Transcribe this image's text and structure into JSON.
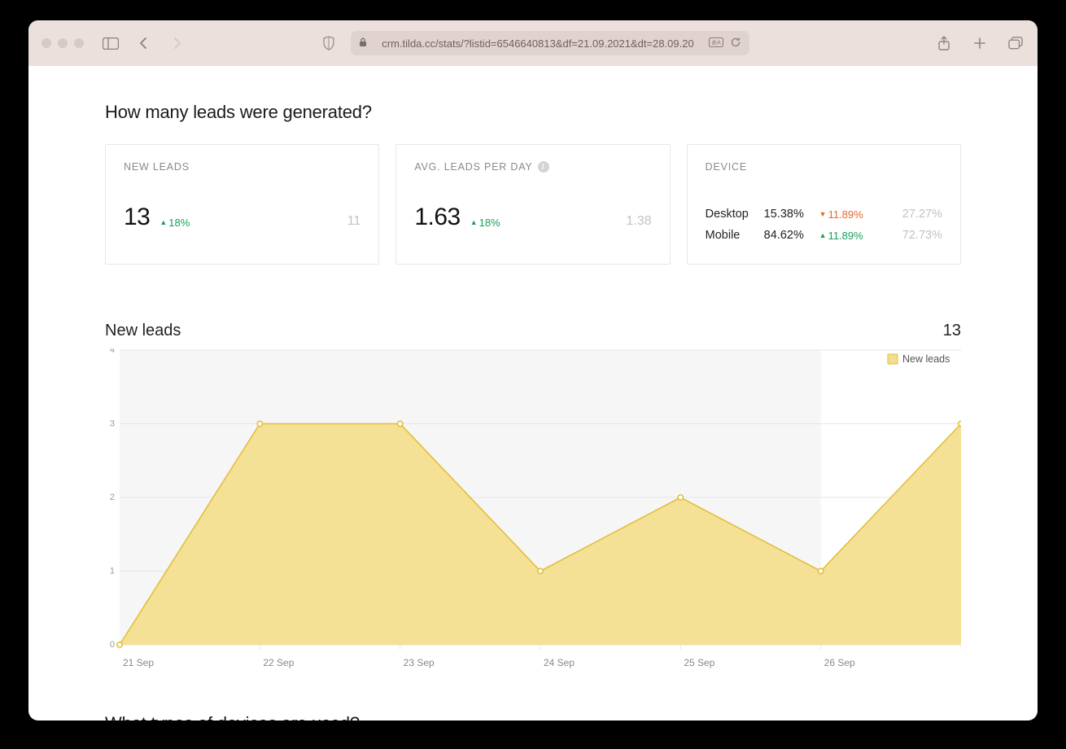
{
  "browser": {
    "url": "crm.tilda.cc/stats/?listid=6546640813&df=21.09.2021&dt=28.09.20"
  },
  "section1_title": "How many leads were generated?",
  "cards": {
    "new_leads": {
      "title": "NEW LEADS",
      "value": "13",
      "delta_dir": "up",
      "delta": "18%",
      "prev": "11"
    },
    "avg_leads": {
      "title": "AVG. LEADS PER DAY",
      "value": "1.63",
      "delta_dir": "up",
      "delta": "18%",
      "prev": "1.38"
    },
    "device": {
      "title": "DEVICE",
      "rows": [
        {
          "label": "Desktop",
          "value": "15.38%",
          "delta_dir": "down",
          "delta": "11.89%",
          "prev": "27.27%"
        },
        {
          "label": "Mobile",
          "value": "84.62%",
          "delta_dir": "up",
          "delta": "11.89%",
          "prev": "72.73%"
        }
      ]
    }
  },
  "chart": {
    "title": "New leads",
    "total": "13",
    "legend": "New leads"
  },
  "section2_title": "What types of devices are used?",
  "chart_data": {
    "type": "area",
    "title": "New leads",
    "xlabel": "",
    "ylabel": "",
    "ylim": [
      0,
      4
    ],
    "yticks": [
      0,
      1,
      2,
      3,
      4
    ],
    "categories": [
      "21 Sep",
      "22 Sep",
      "23 Sep",
      "24 Sep",
      "25 Sep",
      "26 Sep",
      ""
    ],
    "series": [
      {
        "name": "New leads",
        "values": [
          0,
          3,
          3,
          1,
          2,
          1,
          3
        ]
      }
    ],
    "legend_position": "top-right",
    "grid": true
  }
}
